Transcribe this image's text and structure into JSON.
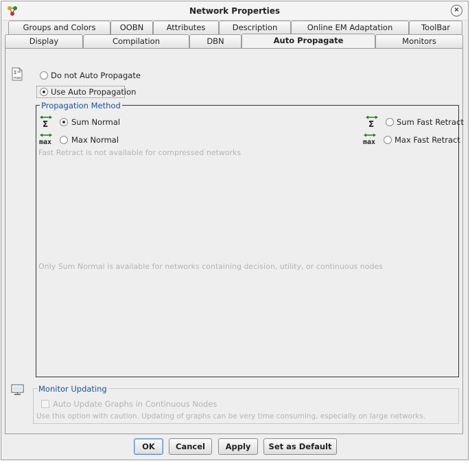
{
  "window": {
    "title": "Network Properties",
    "close_glyph": "×"
  },
  "tabs_row1": [
    {
      "label": "Groups and Colors"
    },
    {
      "label": "OOBN"
    },
    {
      "label": "Attributes"
    },
    {
      "label": "Description"
    },
    {
      "label": "Online EM Adaptation"
    },
    {
      "label": "ToolBar"
    }
  ],
  "tabs_row2": [
    {
      "label": "Display"
    },
    {
      "label": "Compilation"
    },
    {
      "label": "DBN"
    },
    {
      "label": "Auto Propagate",
      "active": true
    },
    {
      "label": "Monitors"
    }
  ],
  "auto_propagate": {
    "option_off": "Do not Auto Propagate",
    "option_on": "Use Auto Propagation",
    "selected": "option_on"
  },
  "propagation_method": {
    "legend": "Propagation Method",
    "sum_normal": "Sum Normal",
    "max_normal": "Max Normal",
    "sum_fast": "Sum Fast Retract",
    "max_fast": "Max Fast Retract",
    "selected": "sum_normal",
    "note_fast": "Fast Retract is not available for compressed networks",
    "note_sum": "Only Sum Normal is available for networks containing decision, utility, or continuous nodes",
    "sum_icon_text": "Σ",
    "max_icon_text": "max"
  },
  "monitor_updating": {
    "legend": "Monitor Updating",
    "checkbox_label": "Auto Update Graphs in Continuous Nodes",
    "checked": false,
    "caution": "Use this option with caution. Updating of graphs can be very time consuming, especially on large networks."
  },
  "buttons": {
    "ok": "OK",
    "cancel": "Cancel",
    "apply": "Apply",
    "default": "Set as Default"
  },
  "colors": {
    "accent": "#1a4f9c",
    "arrow_green": "#1f7a1f",
    "disabled_text": "#b4b4b4"
  }
}
